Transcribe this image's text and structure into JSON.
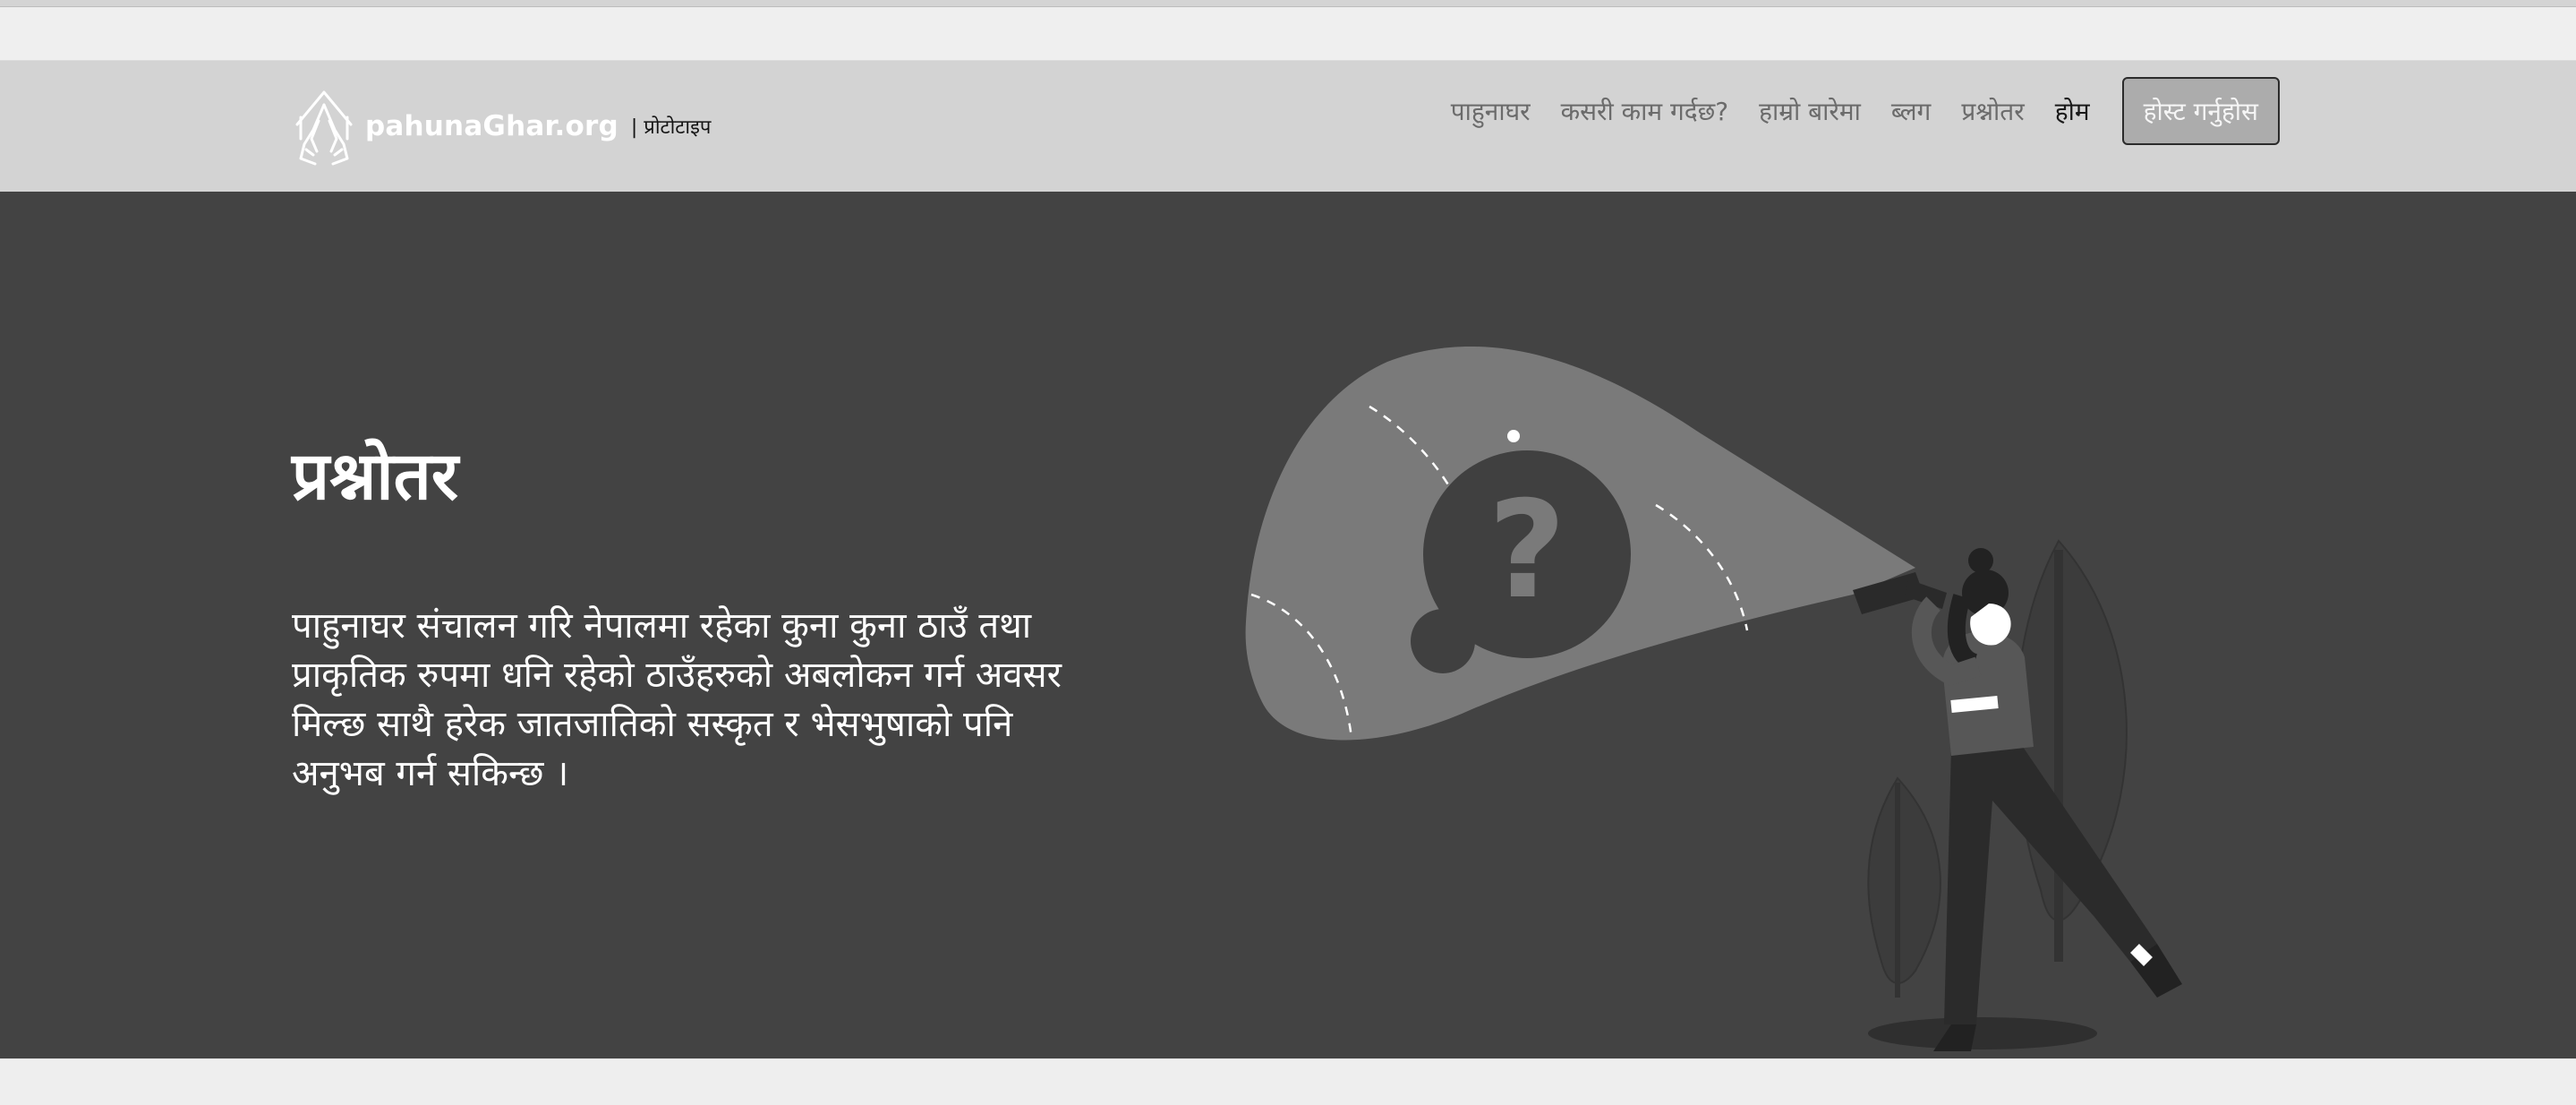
{
  "brand": {
    "name": "pahunaGhar.org",
    "tagline": "| प्रोटोटाइप",
    "logo_icon": "praying-hands-house-icon"
  },
  "nav": {
    "items": [
      {
        "label": "पाहुनाघर",
        "active": false
      },
      {
        "label": "कसरी काम गर्दछ?",
        "active": false
      },
      {
        "label": "हाम्रो बारेमा",
        "active": false
      },
      {
        "label": "ब्लग",
        "active": false
      },
      {
        "label": "प्रश्नोतर",
        "active": false
      },
      {
        "label": "होम",
        "active": true
      }
    ],
    "host_button": "होस्ट गर्नुहोस"
  },
  "hero": {
    "title": "प्रश्नोतर",
    "text": "पाहुनाघर संचालन गरि नेपालमा रहेका कुना कुना ठाउँ तथा प्राकृतिक रुपमा धनि रहेको ठाउँहरुको अबलोकन गर्न अवसर मिल्छ साथै हरेक जातजातिको सस्कृत र भेसभुषाको पनि अनुभब गर्न सकिन्छ ।",
    "illustration_icon": "person-with-flashlight-question-icon"
  },
  "colors": {
    "navbar_bg": "#d3d3d3",
    "hero_bg": "#434343",
    "button_bg": "#acacac"
  }
}
